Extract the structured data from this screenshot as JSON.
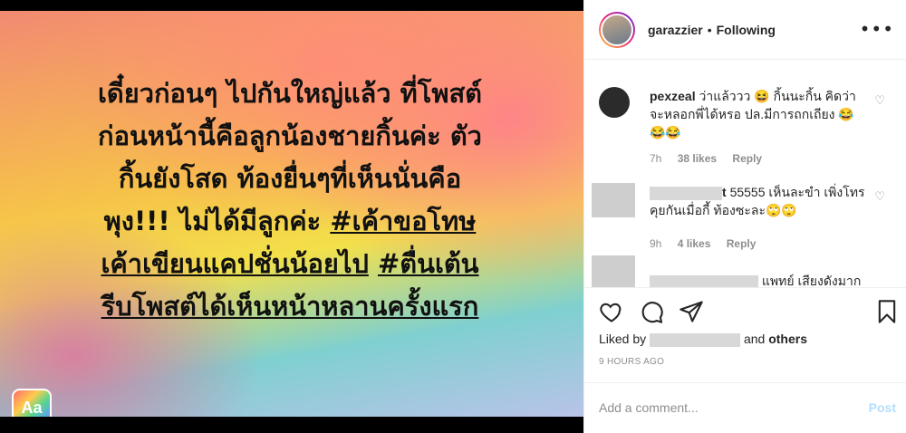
{
  "post": {
    "lines": [
      "เดี๋ยวก่อนๆ ไปกันใหญ่แล้ว ที่โพสต์",
      "ก่อนหน้านี้คือลูกน้องชายกิ้นค่ะ ตัว",
      "กิ้นยังโสด ท้องยื่นๆที่เห็นนั่นคือ",
      "พุง!!! ไม่ได้มีลูกค่ะ ",
      "#เค้าขอโทษ",
      "เค้าเขียนแคปชั่นน้อยไป",
      "#ตื่นเต้น",
      "รีบโพสต์ได้เห็นหน้าหลานครั้งแรก"
    ],
    "badge": "Aa"
  },
  "header": {
    "username": "garazzier",
    "separator": "•",
    "follow_status": "Following",
    "more": "•••"
  },
  "comments": [
    {
      "username": "pexzeal",
      "text": "ว่าแล้ววว 😆 กิ้นนะกิ้น คิดว่าจะหลอกพี่ได้หรอ ปล.มีการถกเถียง 😂😂😂",
      "time": "7h",
      "likes": "38 likes",
      "reply": "Reply"
    },
    {
      "username_visible": "t",
      "text": "55555 เห็นละขำ เพิ่งโทรคุยกันเมื่อกี้ ท้องซะละ🙄🙄",
      "time": "9h",
      "likes": "4 likes",
      "reply": "Reply"
    },
    {
      "text_partial": "แพทย์ เสียงดังมาก"
    }
  ],
  "actions": {
    "like_icon": "heart-icon",
    "comment_icon": "comment-icon",
    "share_icon": "paper-plane-icon",
    "save_icon": "bookmark-icon"
  },
  "liked_by": {
    "prefix": "Liked by",
    "suffix_and": "and",
    "suffix_others": "others"
  },
  "timestamp": "9 HOURS AGO",
  "add_comment": {
    "placeholder": "Add a comment...",
    "post_label": "Post"
  }
}
